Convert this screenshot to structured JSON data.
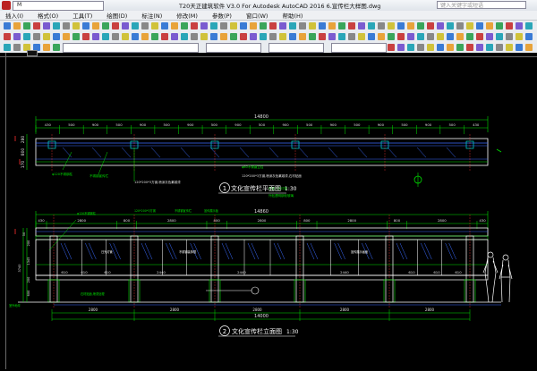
{
  "titlebar": {
    "title": "T20天正建筑软件 V3.0 For Autodesk AutoCAD 2016    6.宣传栏大样图.dwg",
    "search_placeholder": "键入关键字或短语",
    "workspace": "M"
  },
  "menu": [
    "插入(I)",
    "格式(O)",
    "工具(T)",
    "绘图(D)",
    "标注(N)",
    "修改(M)",
    "参数(P)",
    "窗口(W)",
    "帮助(H)"
  ],
  "drawing": {
    "plan": {
      "overall_dim": "14800",
      "top_dims": [
        "430",
        "500",
        "900",
        "500",
        "900",
        "500",
        "900",
        "500",
        "900",
        "500",
        "900",
        "500",
        "900",
        "500",
        "900",
        "500",
        "900",
        "500",
        "430"
      ],
      "left_dims": [
        "280",
        "800",
        "170"
      ],
      "title": "文化宣传栏平面图",
      "number": "1",
      "scale": "1:30",
      "notes": [
        "φ120不锈钢柱",
        "不锈钢宣传栏",
        "120*200*3方钢,喷深灰色氟碳漆",
        "φ60不锈钢立柱",
        "120*200*3方钢,喷深灰色氟碳漆,石材贴面",
        "内置日光灯管",
        "外贴透明钢化玻璃"
      ]
    },
    "elevation": {
      "overall_dim": "14860",
      "top_dims": [
        "430",
        "2800",
        "800",
        "2800",
        "800",
        "2800",
        "800",
        "2800",
        "800",
        "2800",
        "430"
      ],
      "panel_dims": [
        "610",
        "610",
        "610",
        "2440",
        "2440",
        "2440",
        "610",
        "610",
        "610"
      ],
      "bottom_dims": [
        "2800",
        "2800",
        "2800",
        "2800",
        "2800"
      ],
      "bottom_total": "14000",
      "left_dims": [
        "50",
        "200",
        "1345",
        "3740",
        "200",
        "600"
      ],
      "title": "文化宣传栏立面图",
      "number": "2",
      "scale": "1:30",
      "notes": [
        "φ120不锈钢柱",
        "120*200*3方钢",
        "不锈钢宣传栏",
        "宣传展示板",
        "日光灯管",
        "宣传展示画面",
        "不锈钢装饰框",
        "石材贴面,喷漆处理",
        "室外地坪"
      ]
    }
  },
  "colors": {
    "dim": "#00e000",
    "structure": "#ffffff",
    "glass": "#3b6bff",
    "accent": "#ff3030",
    "cyan": "#00d8d8",
    "yellow": "#e8e800"
  }
}
